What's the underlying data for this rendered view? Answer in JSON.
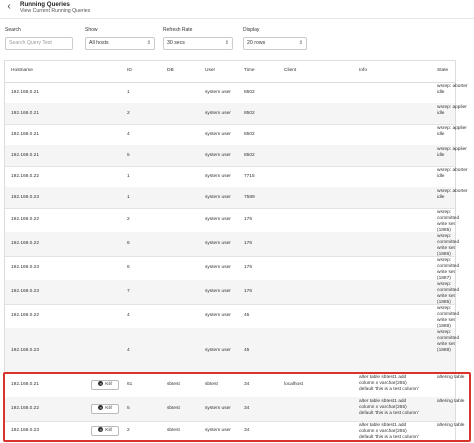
{
  "header": {
    "title": "Running Queries",
    "subtitle": "View Current Running Queries",
    "back_icon": "arrow-left-icon"
  },
  "filters": {
    "search_label": "Search",
    "search_placeholder": "Search Query Text",
    "show_label": "Show",
    "show_value": "All hosts",
    "refresh_label": "Refresh Rate",
    "refresh_value": "30 secs",
    "display_label": "Display",
    "display_value": "20 rows"
  },
  "table": {
    "columns": {
      "hostname": "Hostname",
      "id": "ID",
      "db": "DB",
      "user": "User",
      "time": "Time",
      "client": "Client",
      "info": "Info",
      "state": "State"
    },
    "kill_label": "Kill",
    "rows": [
      {
        "hostname": "192.168.0.21",
        "id": "1",
        "db": "",
        "user": "system user",
        "time": "8502",
        "client": "",
        "info": "",
        "state": "wsrep: aborter idle"
      },
      {
        "hostname": "192.168.0.21",
        "id": "2",
        "db": "",
        "user": "system user",
        "time": "8502",
        "client": "",
        "info": "",
        "state": "wsrep: applier idle"
      },
      {
        "hostname": "192.168.0.21",
        "id": "4",
        "db": "",
        "user": "system user",
        "time": "8502",
        "client": "",
        "info": "",
        "state": "wsrep: applier idle"
      },
      {
        "hostname": "192.168.0.21",
        "id": "5",
        "db": "",
        "user": "system user",
        "time": "8502",
        "client": "",
        "info": "",
        "state": "wsrep: applier idle"
      },
      {
        "hostname": "192.168.0.22",
        "id": "1",
        "db": "",
        "user": "system user",
        "time": "7715",
        "client": "",
        "info": "",
        "state": "wsrep: aborter idle"
      },
      {
        "hostname": "192.168.0.23",
        "id": "1",
        "db": "",
        "user": "system user",
        "time": "7589",
        "client": "",
        "info": "",
        "state": "wsrep: aborter idle"
      },
      {
        "hostname": "192.168.0.22",
        "id": "2",
        "db": "",
        "user": "system user",
        "time": "176",
        "client": "",
        "info": "",
        "state": "wsrep: committed write set (1885)"
      },
      {
        "hostname": "192.168.0.22",
        "id": "6",
        "db": "",
        "user": "system user",
        "time": "176",
        "client": "",
        "info": "",
        "state": "wsrep: committed write set (1886)"
      },
      {
        "hostname": "192.168.0.23",
        "id": "6",
        "db": "",
        "user": "system user",
        "time": "176",
        "client": "",
        "info": "",
        "state": "wsrep: committed write set (1887)"
      },
      {
        "hostname": "192.168.0.23",
        "id": "7",
        "db": "",
        "user": "system user",
        "time": "176",
        "client": "",
        "info": "",
        "state": "wsrep: committed write set (1885)"
      },
      {
        "hostname": "192.168.0.22",
        "id": "4",
        "db": "",
        "user": "system user",
        "time": "45",
        "client": "",
        "info": "",
        "state": "wsrep: committed write set (1888)"
      },
      {
        "hostname": "192.168.0.23",
        "id": "4",
        "db": "",
        "user": "system user",
        "time": "45",
        "client": "",
        "info": "",
        "state": "wsrep: committed write set (1888)"
      },
      {
        "hostname": "192.168.0.21",
        "id": "61",
        "db": "sbtest",
        "user": "sbtest",
        "time": "34",
        "client": "localhost",
        "info": "alter table sbtest1 add column x varchar(255) default 'this is a test column'",
        "state": "altering table"
      },
      {
        "hostname": "192.168.0.22",
        "id": "5",
        "db": "sbtest",
        "user": "system user",
        "time": "34",
        "client": "",
        "info": "alter table sbtest1 add column x varchar(255) default 'this is a test column'",
        "state": "altering table"
      },
      {
        "hostname": "192.168.0.23",
        "id": "2",
        "db": "sbtest",
        "user": "system user",
        "time": "34",
        "client": "",
        "info": "alter table sbtest1 add column x varchar(255) default 'this is a test column'",
        "state": "altering table"
      }
    ]
  },
  "colors": {
    "highlight": "#d9342b",
    "row_alt": "#f5f5f5"
  }
}
